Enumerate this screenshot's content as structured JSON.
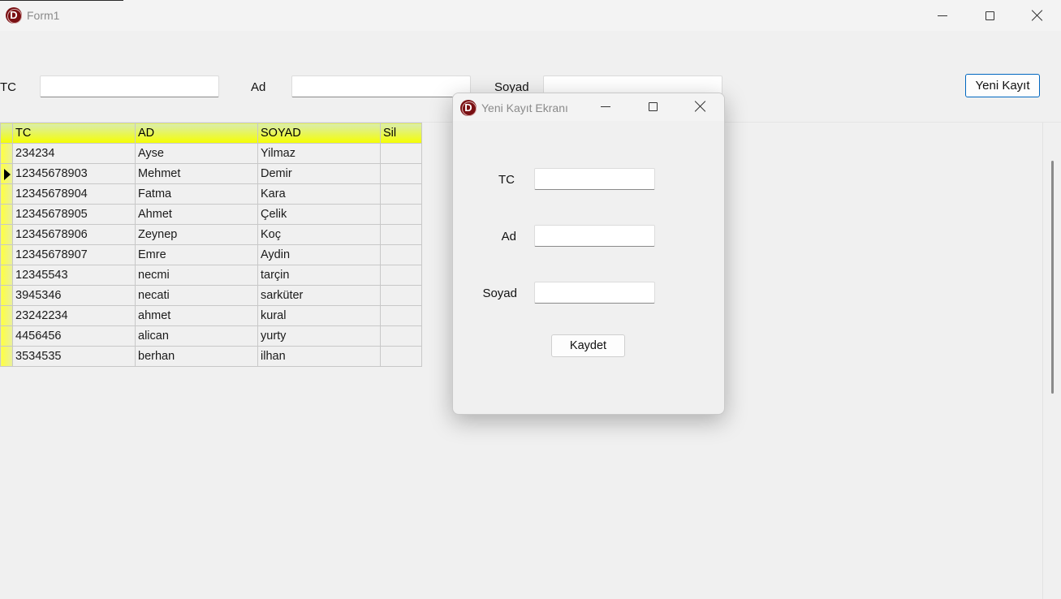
{
  "window": {
    "title": "Form1",
    "icon": "delphi-logo-icon"
  },
  "filters": {
    "tc_label": "TC",
    "tc_value": "",
    "ad_label": "Ad",
    "ad_value": "",
    "soyad_label": "Soyad",
    "soyad_value": "",
    "new_button": "Yeni Kayıt"
  },
  "grid": {
    "columns": [
      "TC",
      "AD",
      "SOYAD",
      "Sil"
    ],
    "rows": [
      {
        "tc": "234234",
        "ad": "Ayse",
        "soyad": "Yilmaz",
        "sil": ""
      },
      {
        "tc": "12345678903",
        "ad": "Mehmet",
        "soyad": "Demir",
        "sil": ""
      },
      {
        "tc": "12345678904",
        "ad": "Fatma",
        "soyad": "Kara",
        "sil": ""
      },
      {
        "tc": "12345678905",
        "ad": "Ahmet",
        "soyad": "Çelik",
        "sil": ""
      },
      {
        "tc": "12345678906",
        "ad": "Zeynep",
        "soyad": "Koç",
        "sil": ""
      },
      {
        "tc": "12345678907",
        "ad": "Emre",
        "soyad": "Aydin",
        "sil": ""
      },
      {
        "tc": "12345543",
        "ad": "necmi",
        "soyad": "tarçin",
        "sil": ""
      },
      {
        "tc": "3945346",
        "ad": "necati",
        "soyad": "sarküter",
        "sil": ""
      },
      {
        "tc": "23242234",
        "ad": "ahmet",
        "soyad": "kural",
        "sil": ""
      },
      {
        "tc": "4456456",
        "ad": "alican",
        "soyad": "yurty",
        "sil": ""
      },
      {
        "tc": "3534535",
        "ad": "berhan",
        "soyad": "ilhan",
        "sil": ""
      }
    ],
    "selected_row_index": 1
  },
  "dialog": {
    "title": "Yeni Kayıt Ekranı",
    "tc_label": "TC",
    "tc_value": "",
    "ad_label": "Ad",
    "ad_value": "",
    "soyad_label": "Soyad",
    "soyad_value": "",
    "save_button": "Kaydet"
  },
  "colors": {
    "grid_header_top": "#d9ecb0",
    "grid_header_bottom": "#f6ff00",
    "indicator": "#ffff30",
    "app_icon": "#7a1013",
    "primary_border": "#0067c0"
  }
}
